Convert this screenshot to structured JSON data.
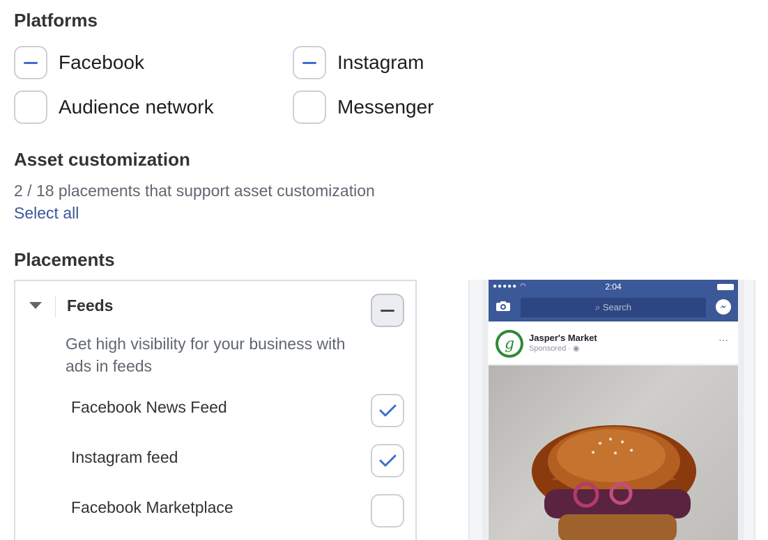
{
  "platforms": {
    "heading": "Platforms",
    "options": [
      {
        "label": "Facebook",
        "state": "indeterminate"
      },
      {
        "label": "Instagram",
        "state": "indeterminate"
      },
      {
        "label": "Audience network",
        "state": "unchecked"
      },
      {
        "label": "Messenger",
        "state": "unchecked"
      }
    ]
  },
  "asset": {
    "heading": "Asset customization",
    "summary": "2 / 18 placements that support asset customization",
    "select_all": "Select all"
  },
  "placements": {
    "heading": "Placements",
    "group": {
      "title": "Feeds",
      "state": "indeterminate",
      "description": "Get high visibility for your business with ads in feeds",
      "items": [
        {
          "label": "Facebook News Feed",
          "checked": true
        },
        {
          "label": "Instagram feed",
          "checked": true
        },
        {
          "label": "Facebook Marketplace",
          "checked": false
        }
      ]
    }
  },
  "preview": {
    "time": "2:04",
    "search_placeholder": "Search",
    "page_name": "Jasper's Market",
    "sponsored": "Sponsored · ",
    "logo_letter": "g",
    "more": "···"
  },
  "colors": {
    "accent": "#3f6dcf",
    "link": "#385898",
    "facebook_blue": "#3b5998"
  }
}
